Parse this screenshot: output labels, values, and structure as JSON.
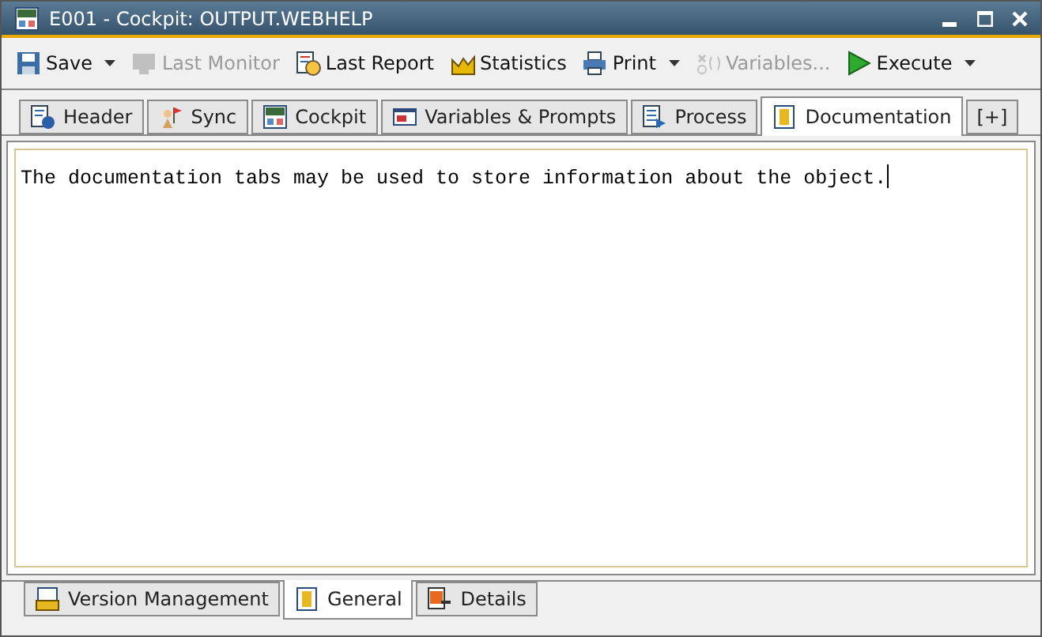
{
  "window": {
    "title": "E001 - Cockpit: OUTPUT.WEBHELP"
  },
  "toolbar": [
    {
      "label": "Save",
      "kind": "floppy",
      "disabled": false,
      "dropdown": true
    },
    {
      "label": "Last Monitor",
      "kind": "monitor",
      "disabled": true,
      "dropdown": false
    },
    {
      "label": "Last Report",
      "kind": "report",
      "disabled": false,
      "dropdown": false
    },
    {
      "label": "Statistics",
      "kind": "chart",
      "disabled": false,
      "dropdown": false
    },
    {
      "label": "Print",
      "kind": "printer",
      "disabled": false,
      "dropdown": true
    },
    {
      "label": "Variables...",
      "kind": "variables",
      "disabled": true,
      "dropdown": false
    },
    {
      "label": "Execute",
      "kind": "play",
      "disabled": false,
      "dropdown": true
    }
  ],
  "tabs": [
    {
      "label": "Header",
      "kind": "info",
      "selected": false
    },
    {
      "label": "Sync",
      "kind": "sync",
      "selected": false
    },
    {
      "label": "Cockpit",
      "kind": "cockpit",
      "selected": false
    },
    {
      "label": "Variables & Prompts",
      "kind": "vars",
      "selected": false
    },
    {
      "label": "Process",
      "kind": "process",
      "selected": false
    },
    {
      "label": "Documentation",
      "kind": "book",
      "selected": true
    },
    {
      "label": "[+]",
      "kind": "plain",
      "selected": false
    }
  ],
  "editor": {
    "value": "The documentation tabs may be used to store information about the object."
  },
  "bottom_tabs": [
    {
      "label": "Version Management",
      "kind": "ucs",
      "selected": false
    },
    {
      "label": "General",
      "kind": "book",
      "selected": true
    },
    {
      "label": "Details",
      "kind": "details",
      "selected": false
    }
  ]
}
